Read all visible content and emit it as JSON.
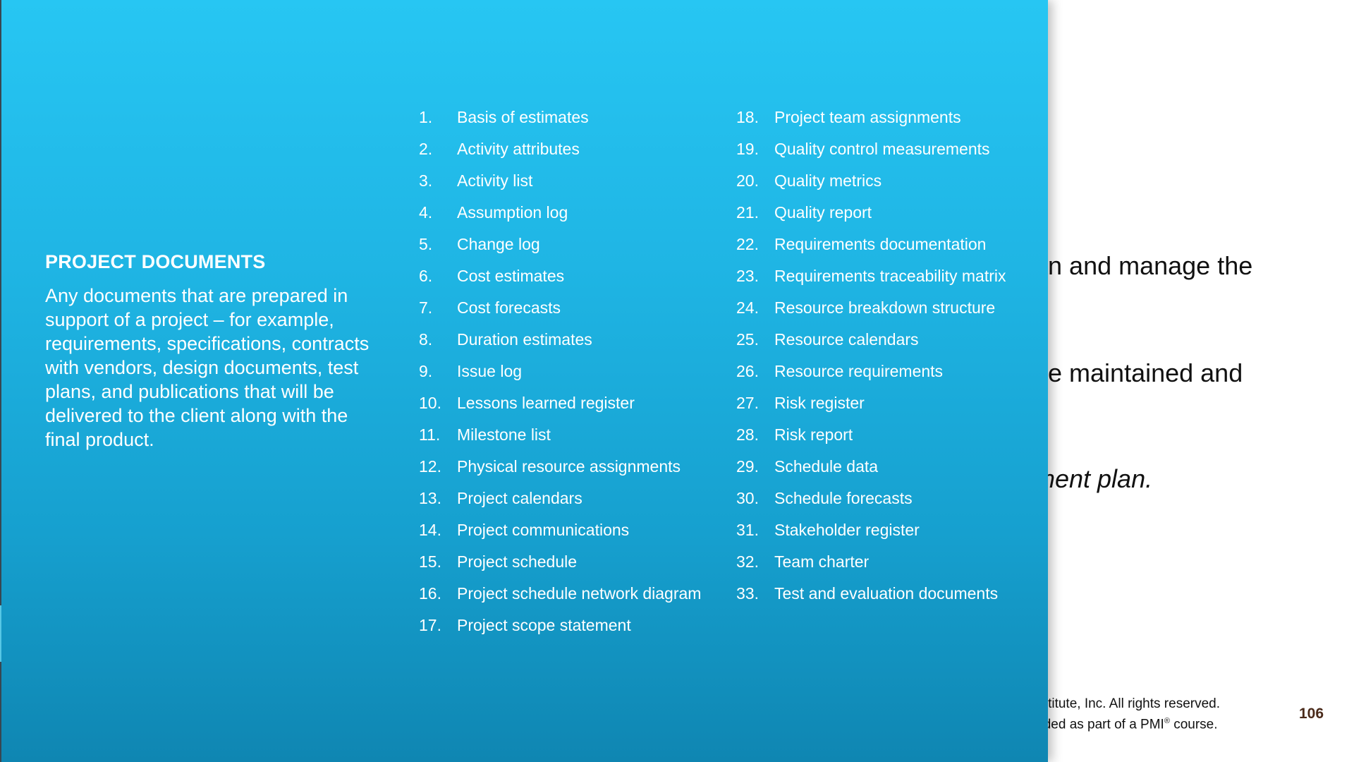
{
  "slide": {
    "lines": [
      "an and manage the",
      "be maintained and",
      "ment plan."
    ],
    "footer": {
      "line1": "nstitute, Inc. All rights reserved.",
      "line2_pre": "vided as part of a PMI",
      "line2_reg": "®",
      "line2_post": " course."
    },
    "page_number": "106"
  },
  "definition": {
    "title": "PROJECT DOCUMENTS",
    "body": "Any documents that are prepared in support of a project – for example, requirements, specifications, contracts with vendors, design documents, test plans, and publications that will be delivered to the client along with the final product."
  },
  "documents": {
    "column1": [
      {
        "num": "1.",
        "text": "Basis of estimates"
      },
      {
        "num": "2.",
        "text": "Activity attributes"
      },
      {
        "num": "3.",
        "text": "Activity list"
      },
      {
        "num": "4.",
        "text": "Assumption log"
      },
      {
        "num": "5.",
        "text": "Change log"
      },
      {
        "num": "6.",
        "text": "Cost estimates"
      },
      {
        "num": "7.",
        "text": "Cost forecasts"
      },
      {
        "num": "8.",
        "text": "Duration estimates"
      },
      {
        "num": "9.",
        "text": "Issue log"
      },
      {
        "num": "10.",
        "text": "Lessons learned register"
      },
      {
        "num": "11.",
        "text": "Milestone list"
      },
      {
        "num": "12.",
        "text": "Physical resource assignments"
      },
      {
        "num": "13.",
        "text": "Project calendars"
      },
      {
        "num": "14.",
        "text": "Project communications"
      },
      {
        "num": "15.",
        "text": "Project schedule"
      },
      {
        "num": "16.",
        "text": "Project schedule network diagram"
      },
      {
        "num": "17.",
        "text": "Project scope statement"
      }
    ],
    "column2": [
      {
        "num": "18.",
        "text": "Project team assignments"
      },
      {
        "num": "19.",
        "text": "Quality control measurements"
      },
      {
        "num": "20.",
        "text": "Quality metrics"
      },
      {
        "num": "21.",
        "text": "Quality report"
      },
      {
        "num": "22.",
        "text": "Requirements documentation"
      },
      {
        "num": "23.",
        "text": "Requirements traceability matrix"
      },
      {
        "num": "24.",
        "text": "Resource breakdown structure"
      },
      {
        "num": "25.",
        "text": "Resource calendars"
      },
      {
        "num": "26.",
        "text": "Resource requirements"
      },
      {
        "num": "27.",
        "text": "Risk register"
      },
      {
        "num": "28.",
        "text": "Risk report"
      },
      {
        "num": "29.",
        "text": "Schedule data"
      },
      {
        "num": "30.",
        "text": "Schedule forecasts"
      },
      {
        "num": "31.",
        "text": "Stakeholder register"
      },
      {
        "num": "32.",
        "text": "Team charter"
      },
      {
        "num": "33.",
        "text": "Test and evaluation documents"
      }
    ]
  },
  "colors": {
    "overlay_top": "#27c6f3",
    "overlay_bottom": "#0f86b2",
    "page_number": "#4a2a1a"
  }
}
